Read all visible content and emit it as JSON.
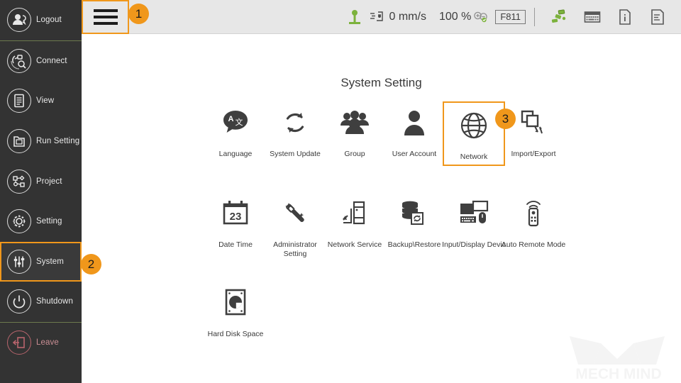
{
  "sidebar": {
    "items": [
      {
        "label": "Logout",
        "icon": "logout-user-icon",
        "selected": false,
        "sep_after": true
      },
      {
        "label": "Connect",
        "icon": "connect-icon",
        "selected": false,
        "sep_after": false
      },
      {
        "label": "View",
        "icon": "view-list-icon",
        "selected": false,
        "sep_after": false
      },
      {
        "label": "Run Setting",
        "icon": "folder-run-icon",
        "selected": false,
        "sep_after": false
      },
      {
        "label": "Project",
        "icon": "project-nodes-icon",
        "selected": false,
        "sep_after": false
      },
      {
        "label": "Setting",
        "icon": "gear-icon",
        "selected": false,
        "sep_after": false
      },
      {
        "label": "System",
        "icon": "sliders-icon",
        "selected": true,
        "sep_after": false
      },
      {
        "label": "Shutdown",
        "icon": "power-icon",
        "selected": false,
        "sep_after": true
      },
      {
        "label": "Leave",
        "icon": "exit-door-icon",
        "selected": false,
        "sep_after": false
      }
    ]
  },
  "topbar": {
    "menu_button": "hamburger-menu",
    "jog_icon": "joystick-icon",
    "speed_icon": "robot-speed-icon",
    "speed_value": "0 mm/s",
    "zoom_value": "100 %",
    "zoom_icon": "zoom-in-out-icon",
    "function_key": "F811",
    "robot_icon": "robot-arm-icon",
    "keyboard_icon": "keyboard-icon",
    "info_icon": "info-icon",
    "log_icon": "log-document-icon"
  },
  "main": {
    "title": "System Setting",
    "rows": [
      {
        "items": [
          {
            "label": "Language",
            "icon": "language-translate-icon",
            "selected": false
          },
          {
            "label": "System Update",
            "icon": "system-update-icon",
            "selected": false
          },
          {
            "label": "Group",
            "icon": "user-group-icon",
            "selected": false
          },
          {
            "label": "User Account",
            "icon": "user-account-icon",
            "selected": false
          },
          {
            "label": "Network",
            "icon": "globe-network-icon",
            "selected": true
          },
          {
            "label": "Import/Export",
            "icon": "import-export-icon",
            "selected": false
          }
        ]
      },
      {
        "items": [
          {
            "label": "Date Time",
            "icon": "calendar-23-icon",
            "selected": false
          },
          {
            "label": "Administrator Setting",
            "icon": "magic-wand-icon",
            "selected": false
          },
          {
            "label": "Network Service",
            "icon": "server-tower-icon",
            "selected": false
          },
          {
            "label": "Backup\\Restore",
            "icon": "backup-restore-icon",
            "selected": false
          },
          {
            "label": "Input/Display Devic",
            "icon": "input-display-icon",
            "selected": false
          },
          {
            "label": "Auto Remote Mode",
            "icon": "remote-control-icon",
            "selected": false
          }
        ]
      },
      {
        "items": [
          {
            "label": "Hard Disk Space",
            "icon": "hard-disk-icon",
            "selected": false
          }
        ]
      }
    ]
  },
  "badges": [
    {
      "number": "1",
      "target": "hamburger-menu"
    },
    {
      "number": "2",
      "target": "sidebar-item-system"
    },
    {
      "number": "3",
      "target": "tile-network"
    }
  ],
  "watermark": {
    "text": "MECH MIND"
  },
  "colors": {
    "accent": "#f0971b",
    "sidebar_bg": "#333333",
    "topbar_bg": "#e7e7e7",
    "content_bg": "#ffffff",
    "green": "#7cb23c",
    "separator_green": "#6d7a4e",
    "icon_dark": "#3f3f3f"
  }
}
